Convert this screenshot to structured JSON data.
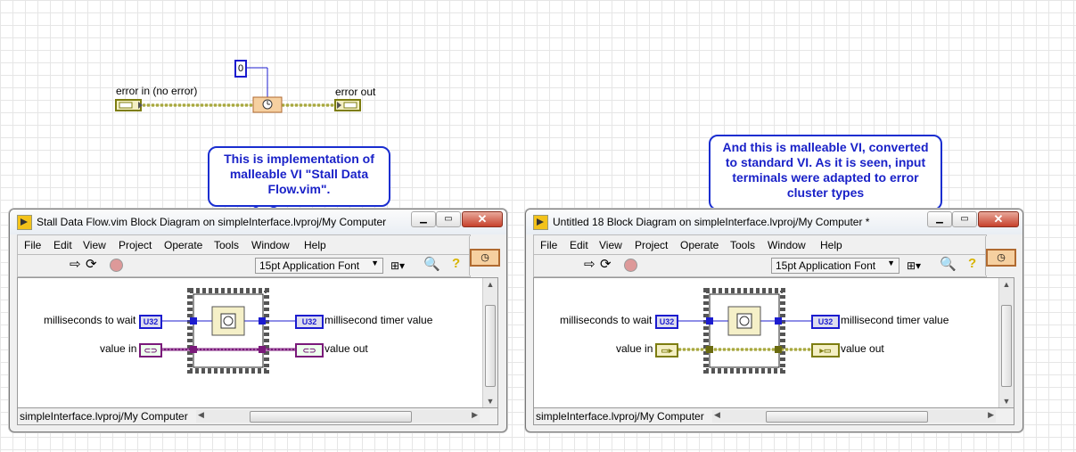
{
  "top_diagram": {
    "constant_value": "0",
    "error_in_label": "error in (no error)",
    "error_out_label": "error out"
  },
  "callouts": {
    "left": "This is implementation of malleable VI \"Stall Data Flow.vim\".",
    "right": "And this is malleable VI, converted to standard VI. As it is seen, input terminals were adapted to error cluster types"
  },
  "window_left": {
    "title": "Stall Data Flow.vim Block Diagram on simpleInterface.lvproj/My Computer",
    "menu": [
      "File",
      "Edit",
      "View",
      "Project",
      "Operate",
      "Tools",
      "Window",
      "Help"
    ],
    "font_select": "15pt Application Font",
    "status": "simpleInterface.lvproj/My Computer",
    "ms_to_wait": "milliseconds to wait",
    "ms_timer": "millisecond timer value",
    "value_in": "value in",
    "value_out": "value out",
    "u32": "U32"
  },
  "window_right": {
    "title": "Untitled 18 Block Diagram on simpleInterface.lvproj/My Computer *",
    "menu": [
      "File",
      "Edit",
      "View",
      "Project",
      "Operate",
      "Tools",
      "Window",
      "Help"
    ],
    "font_select": "15pt Application Font",
    "status": "simpleInterface.lvproj/My Computer",
    "ms_to_wait": "milliseconds to wait",
    "ms_timer": "millisecond timer value",
    "value_in": "value in",
    "value_out": "value out",
    "u32": "U32"
  },
  "colors": {
    "callout_text": "#1a22c8",
    "u32_blue": "#1c1ccf",
    "variant_purple": "#7a1a7a",
    "error_wire": "#8a8a10",
    "grid": "#e6e6e6"
  },
  "icons": [
    "run-arrow-icon",
    "run-continuously-icon",
    "abort-icon",
    "align-icon",
    "search-icon",
    "help-icon",
    "timer-icon",
    "vi-icon"
  ]
}
